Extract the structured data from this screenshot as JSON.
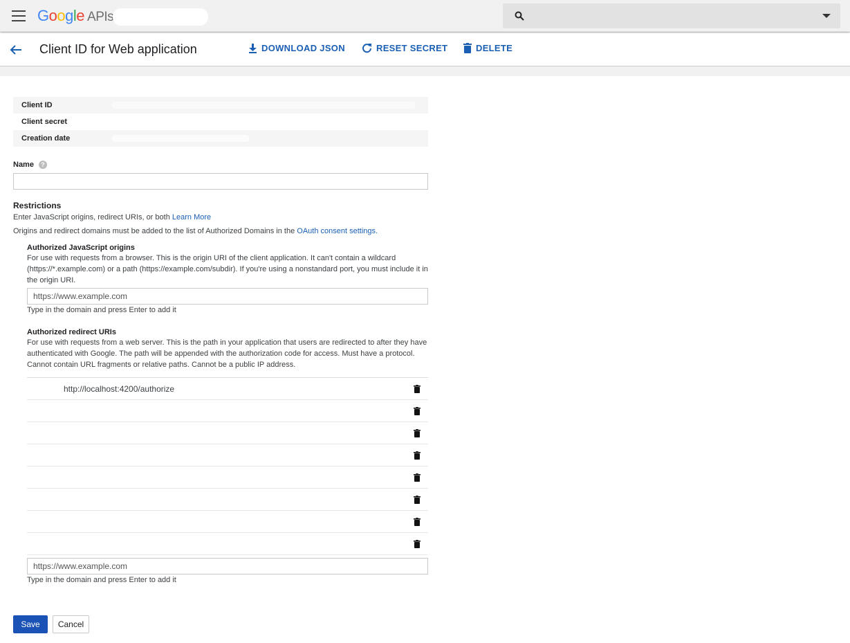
{
  "topbar": {
    "logo_google": "Google",
    "logo_apis": "APIs"
  },
  "header": {
    "title": "Client ID for Web application",
    "actions": {
      "download": "DOWNLOAD JSON",
      "reset": "RESET SECRET",
      "delete": "DELETE"
    }
  },
  "info": {
    "client_id_label": "Client ID",
    "client_secret_label": "Client secret",
    "creation_date_label": "Creation date"
  },
  "name": {
    "label": "Name",
    "help": "?"
  },
  "restrictions": {
    "title": "Restrictions",
    "line1_text": "Enter JavaScript origins, redirect URIs, or both ",
    "line1_link": "Learn More",
    "line2_text": "Origins and redirect domains must be added to the list of Authorized Domains in the ",
    "line2_link": "OAuth consent settings."
  },
  "js_origins": {
    "title": "Authorized JavaScript origins",
    "description": "For use with requests from a browser. This is the origin URI of the client application. It can't contain a wildcard (https://*.example.com) or a path (https://example.com/subdir). If you're using a nonstandard port, you must include it in the origin URI.",
    "input_value": "https://www.example.com",
    "hint": "Type in the domain and press Enter to add it"
  },
  "redirect_uris": {
    "title": "Authorized redirect URIs",
    "description": "For use with requests from a web server. This is the path in your application that users are redirected to after they have authenticated with Google. The path will be appended with the authorization code for access. Must have a protocol. Cannot contain URL fragments or relative paths. Cannot be a public IP address.",
    "items": [
      "http://localhost:4200/authorize",
      "",
      "",
      "",
      "",
      "",
      "",
      ""
    ],
    "input_value": "https://www.example.com",
    "hint": "Type in the domain and press Enter to add it"
  },
  "buttons": {
    "save": "Save",
    "cancel": "Cancel"
  },
  "colors": {
    "accent": "#1a5fb4",
    "save_bg": "#1a53b5"
  }
}
